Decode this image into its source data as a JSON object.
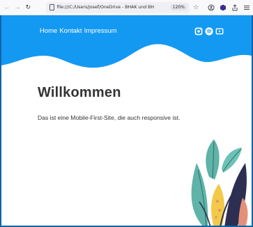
{
  "browser": {
    "back_icon": "back-arrow-icon",
    "forward_icon": "forward-arrow-icon",
    "reload_icon": "reload-icon",
    "url": "file:///C:/Users/josef/OneDrive - BHAK und BH",
    "zoom": "120%",
    "toolbar_icons": [
      "bookmark-star-icon",
      "account-icon",
      "extension-icon",
      "share-icon",
      "menu-icon"
    ]
  },
  "header": {
    "nav": [
      "Home",
      "Kontakt",
      "Impressum"
    ],
    "social_icons": [
      "instagram-icon",
      "spotify-icon",
      "youtube-icon"
    ],
    "accent_color": "#1499f2"
  },
  "main": {
    "title": "Willkommen",
    "lead": "Das ist eine Mobile-First-Site, die auch responsive ist."
  }
}
